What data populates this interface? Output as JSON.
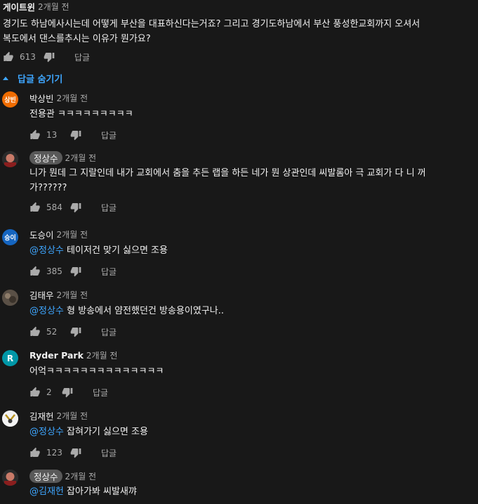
{
  "top": {
    "author": "게이트윈",
    "time": "2개월 전",
    "text_line1": "경기도 하남에사시는데 어떻게 부산을 대표하신다는거죠? 그리고 경기도하남에서 부산 풍성한교회까지 오셔서",
    "text_line2": "복도에서 댄스를추시는 이유가 뭔가요?",
    "likes": "613",
    "reply_label": "답글"
  },
  "hide_replies_label": "답글 숨기기",
  "replies": [
    {
      "author": "박상빈",
      "time": "2개월 전",
      "avatar_text": "상빈",
      "avatar_color": "#ef6c00",
      "text": "전용관    ㅋㅋㅋㅋㅋㅋㅋㅋㅋ",
      "likes": "13",
      "reply_label": "답글"
    },
    {
      "author": "정상수",
      "time": "2개월 전",
      "text_line1": "니가 뭔데 그 지랄인데 내가 교회에서 춤을 추든 랩을 하든 네가 뭔 상관인데 씨발롬아 극 교회가 다 니 꺼",
      "text_line2": "가??????",
      "likes": "584",
      "reply_label": "답글"
    },
    {
      "author": "도승이",
      "time": "2개월 전",
      "avatar_text": "승이",
      "avatar_color": "#1565c0",
      "mention": "@정상수",
      "text": " 테이저건 맞기 싫으면 조용",
      "likes": "385",
      "reply_label": "답글"
    },
    {
      "author": "김태우",
      "time": "2개월 전",
      "mention": "@정상수",
      "text": " 형 방송에서 얌전했던건 방송용이였구나..",
      "likes": "52",
      "reply_label": "답글"
    },
    {
      "author": "Ryder Park",
      "time": "2개월 전",
      "avatar_text": "R",
      "avatar_color": "#0097a7",
      "text": "어억ㅋㅋㅋㅋㅋㅋㅋㅋㅋㅋㅋㅋㅋㅋ",
      "likes": "2",
      "reply_label": "답글"
    },
    {
      "author": "김재헌",
      "time": "2개월 전",
      "mention": "@정상수",
      "text": " 잡혀가기 싫으면 조용",
      "likes": "123",
      "reply_label": "답글"
    },
    {
      "author": "정상수",
      "time": "2개월 전",
      "mention": "@김재헌",
      "text": " 잡아가봐 씨발새꺄"
    }
  ]
}
